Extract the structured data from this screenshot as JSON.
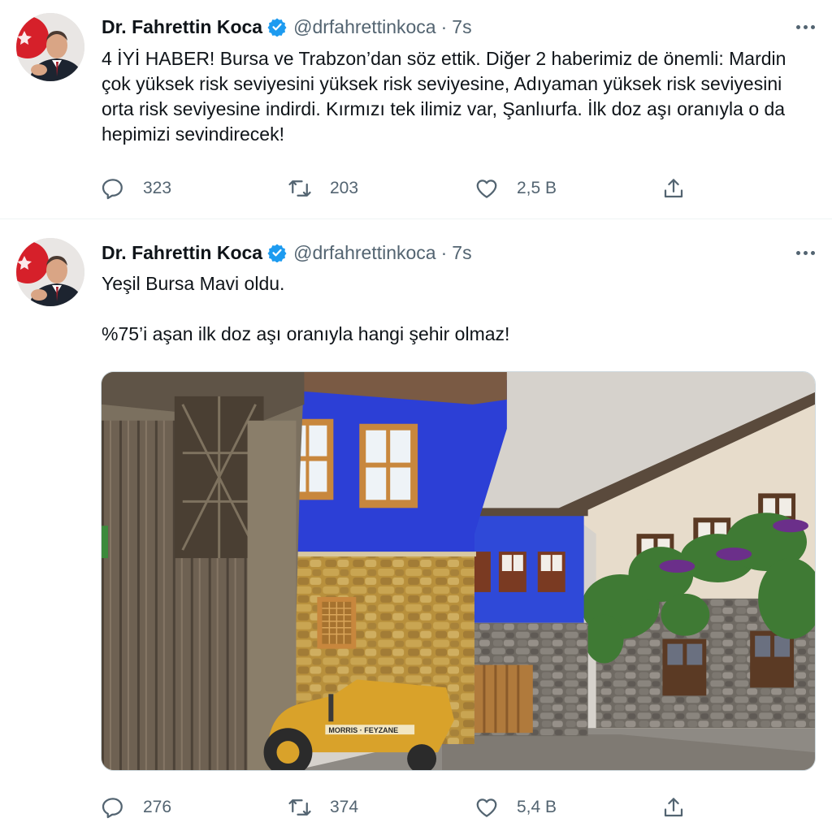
{
  "tweets": [
    {
      "author": {
        "name": "Dr. Fahrettin Koca",
        "handle": "@drfahrettinkoca"
      },
      "separator": "·",
      "time": "7s",
      "text": "4 İYİ HABER! Bursa ve Trabzon’dan söz ettik. Diğer 2 haberimiz de önemli: Mardin çok yüksek risk seviyesini yüksek risk seviyesine, Adıyaman yüksek risk seviyesini orta risk seviyesine indirdi. Kırmızı tek ilimiz var, Şanlıurfa. İlk doz aşı oranıyla o da hepimizi sevindirecek!",
      "replies": "323",
      "retweets": "203",
      "likes": "2,5 B"
    },
    {
      "author": {
        "name": "Dr. Fahrettin Koca",
        "handle": "@drfahrettinkoca"
      },
      "separator": "·",
      "time": "7s",
      "text_line1": "Yeşil Bursa Mavi oldu.",
      "text_line2": "%75’i aşan ilk doz aşı oranıyla hangi şehir olmaz!",
      "replies": "276",
      "retweets": "374",
      "likes": "5,4 B"
    }
  ],
  "media": {
    "tractor_text": "MORRIS · FEYZANE"
  },
  "icons": {
    "verified": "verified-badge-icon",
    "more": "more-dots-icon",
    "reply": "reply-icon",
    "retweet": "retweet-icon",
    "like": "heart-icon",
    "share": "share-icon"
  },
  "colors": {
    "verified": "#1d9bf0",
    "muted": "#536471",
    "text": "#0f1419",
    "blue_house": "#2b3fd6"
  }
}
